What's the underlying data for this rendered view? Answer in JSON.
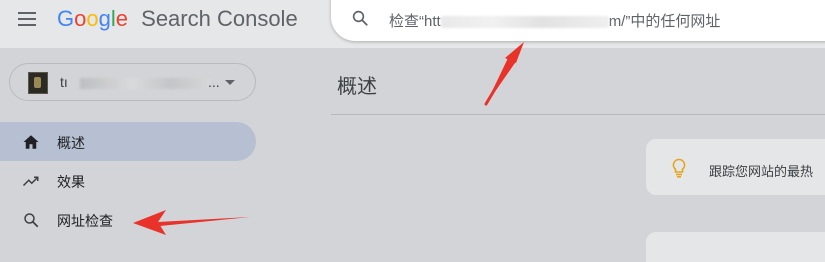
{
  "header": {
    "brand": {
      "letters": [
        {
          "char": "G",
          "color": "#4285F4"
        },
        {
          "char": "o",
          "color": "#EA4335"
        },
        {
          "char": "o",
          "color": "#FBBC05"
        },
        {
          "char": "g",
          "color": "#4285F4"
        },
        {
          "char": "l",
          "color": "#34A853"
        },
        {
          "char": "e",
          "color": "#EA4335"
        }
      ],
      "product": "Search Console"
    },
    "search": {
      "prefix": "检查“htt",
      "suffix": "m/”中的任何网址"
    }
  },
  "sidebar": {
    "property": {
      "name_start": "tı",
      "name_end": "..."
    },
    "items": [
      {
        "label": "概述",
        "icon": "home-icon",
        "active": true
      },
      {
        "label": "效果",
        "icon": "trending-up-icon",
        "active": false
      },
      {
        "label": "网址检查",
        "icon": "search-icon",
        "active": false
      }
    ]
  },
  "main": {
    "title": "概述",
    "tip": {
      "text": "跟踪您网站的最热",
      "icon": "lightbulb-icon"
    }
  },
  "colors": {
    "annotation_red": "#e8322a",
    "bulb_orange": "#e8a317",
    "active_nav": "#b6c0d2"
  }
}
